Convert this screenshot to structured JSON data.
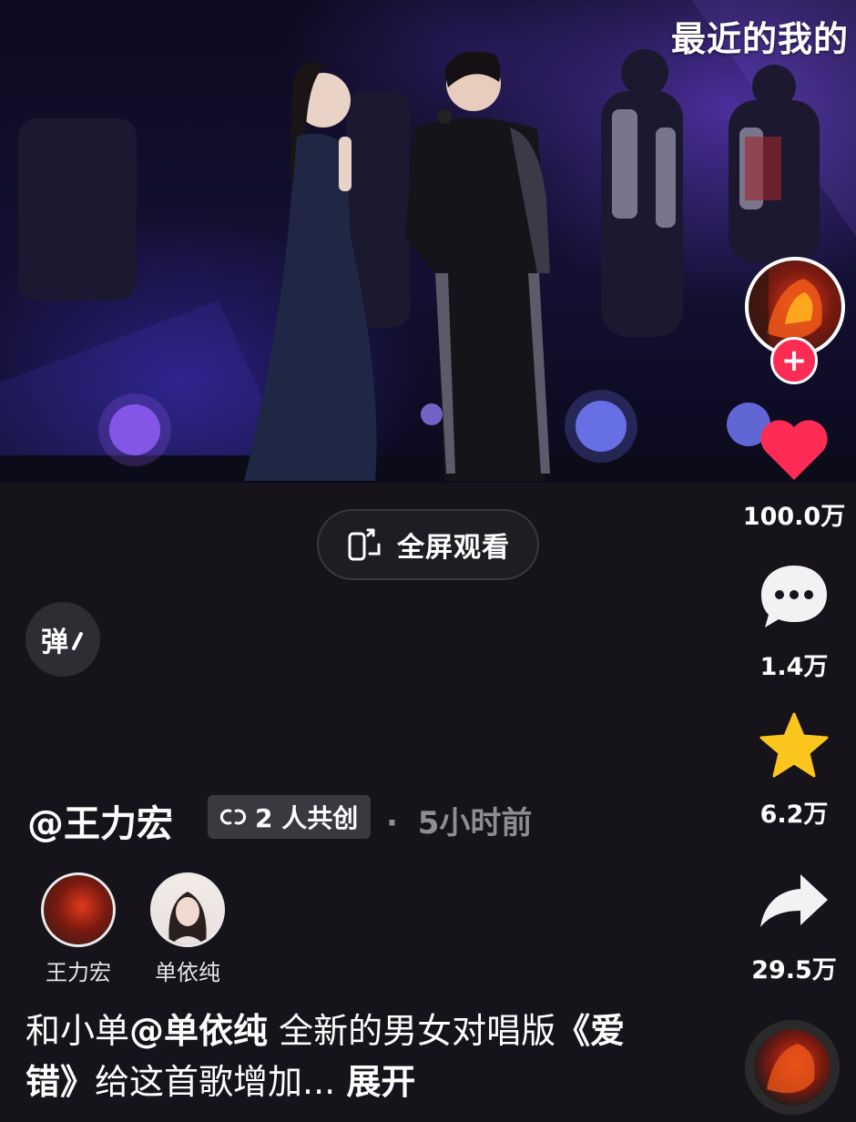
{
  "video": {
    "overlay_title": "最近的我的"
  },
  "actions": {
    "likes": "100.0万",
    "comments": "1.4万",
    "favorites": "6.2万",
    "shares": "29.5万",
    "follow_symbol": "+"
  },
  "fullscreen": {
    "label": "全屏观看"
  },
  "danmaku": {
    "label": "弹"
  },
  "author": {
    "name": "@王力宏",
    "cocreate_label": "2 人共创",
    "separator": "·",
    "time": "5小时前"
  },
  "cocreators": [
    {
      "name": "王力宏"
    },
    {
      "name": "单依纯"
    }
  ],
  "caption": {
    "prefix": "和小单",
    "mention": "@单依纯",
    "middle": " 全新的男女对唱版",
    "song": "《爱错》",
    "suffix": "给这首歌增加...",
    "expand_label": "展开"
  },
  "colors": {
    "background": "#16141a",
    "like": "#fe2c55",
    "favorite": "#fcc51d",
    "muted_text": "#8f8d93"
  },
  "icons": [
    "heart-icon",
    "comment-icon",
    "star-icon",
    "share-icon",
    "fullscreen-icon",
    "link-icon"
  ]
}
